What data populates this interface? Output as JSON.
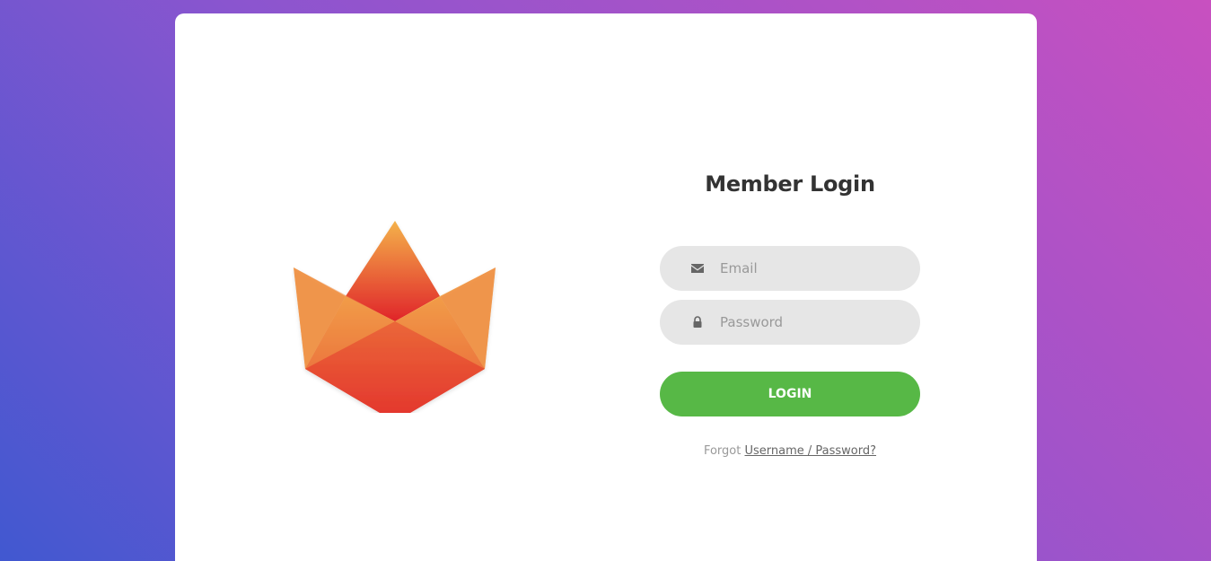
{
  "form": {
    "title": "Member Login",
    "email": {
      "placeholder": "Email",
      "value": "",
      "icon": "envelope-icon"
    },
    "password": {
      "placeholder": "Password",
      "value": "",
      "icon": "lock-icon"
    },
    "login_label": "LOGIN",
    "forgot_prefix": "Forgot",
    "forgot_link": "Username / Password?"
  },
  "colors": {
    "background_start": "#4158d0",
    "background_end": "#c850c0",
    "card": "#ffffff",
    "input_bg": "#e6e6e6",
    "login_button": "#57b846",
    "title_text": "#333333",
    "logo_top": "#f4b24a",
    "logo_bottom": "#e0242a"
  }
}
